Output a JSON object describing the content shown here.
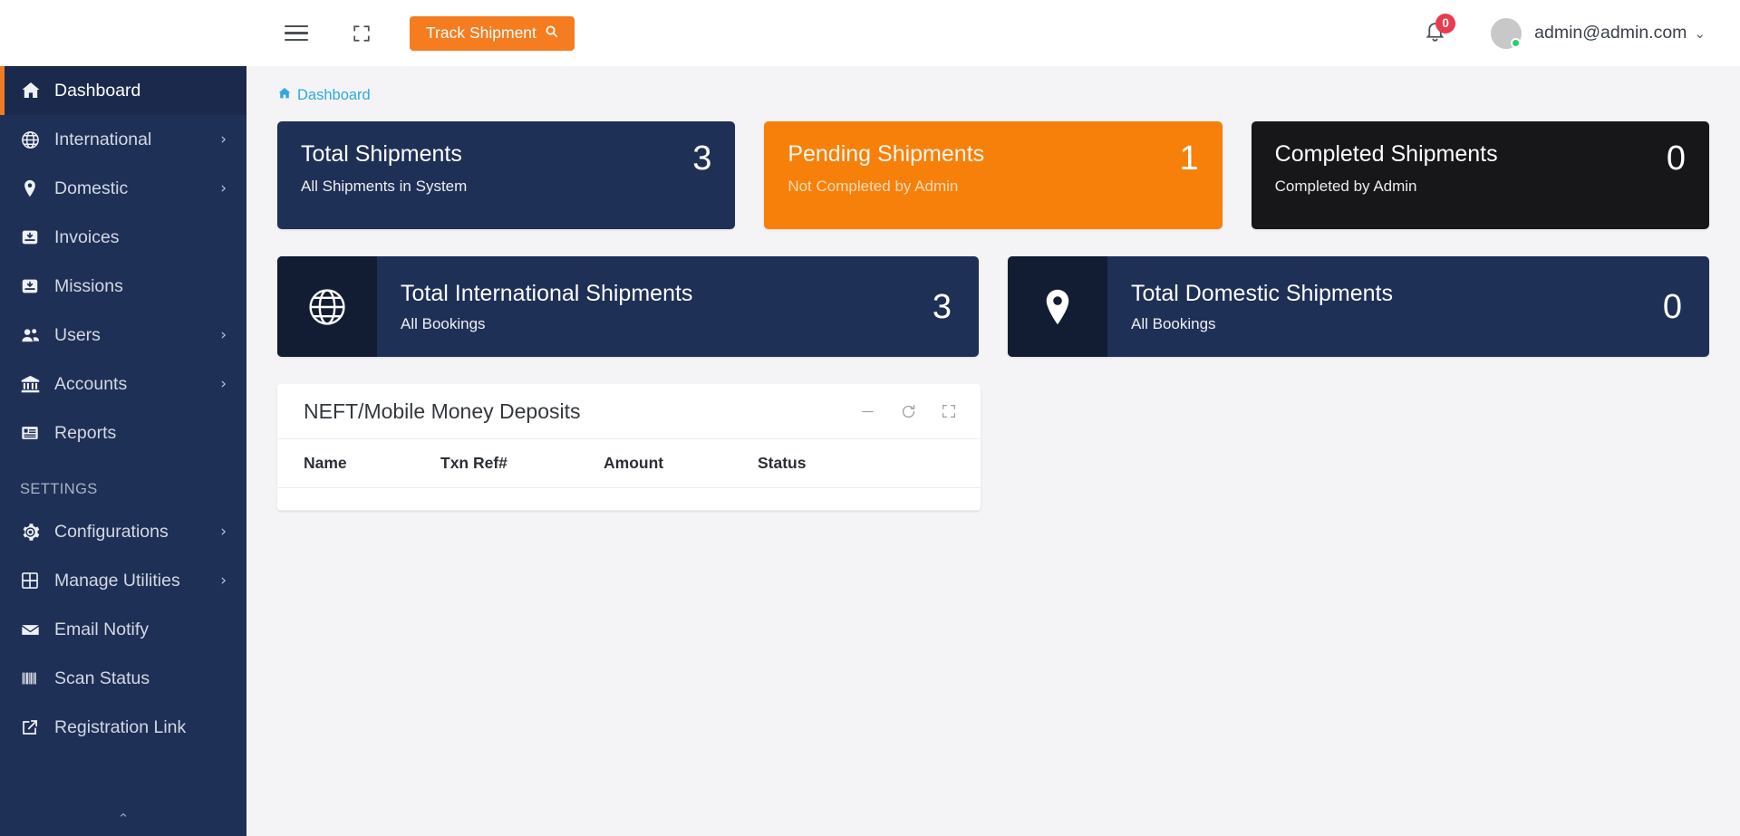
{
  "topbar": {
    "menu_icon": "hamburger-menu-icon",
    "fullscreen_icon": "fullscreen-icon",
    "track_button_label": "Track Shipment",
    "track_button_icon": "search-icon",
    "notification_icon": "bell-icon",
    "notification_count": "0",
    "user_email": "admin@admin.com",
    "user_chevron": "⌄"
  },
  "sidebar": {
    "items": [
      {
        "label": "Dashboard",
        "icon": "home-icon",
        "active": true,
        "caret": ""
      },
      {
        "label": "International",
        "icon": "globe-icon",
        "active": false,
        "caret": "›"
      },
      {
        "label": "Domestic",
        "icon": "map-pin-icon",
        "active": false,
        "caret": "›"
      },
      {
        "label": "Invoices",
        "icon": "inbox-download-icon",
        "active": false,
        "caret": ""
      },
      {
        "label": "Missions",
        "icon": "inbox-download-icon",
        "active": false,
        "caret": ""
      },
      {
        "label": "Users",
        "icon": "users-icon",
        "active": false,
        "caret": "›"
      },
      {
        "label": "Accounts",
        "icon": "bank-icon",
        "active": false,
        "caret": "›"
      },
      {
        "label": "Reports",
        "icon": "report-list-icon",
        "active": false,
        "caret": ""
      }
    ],
    "section_label": "SETTINGS",
    "settings_items": [
      {
        "label": "Configurations",
        "icon": "gear-icon",
        "caret": "›"
      },
      {
        "label": "Manage Utilities",
        "icon": "grid-icon",
        "caret": "›"
      },
      {
        "label": "Email Notify",
        "icon": "envelope-icon",
        "caret": ""
      },
      {
        "label": "Scan Status",
        "icon": "barcode-icon",
        "caret": ""
      },
      {
        "label": "Registration Link",
        "icon": "external-link-icon",
        "caret": ""
      }
    ],
    "collapse_chevron": "⌃"
  },
  "breadcrumb": {
    "icon": "home-icon",
    "label": "Dashboard"
  },
  "stats": [
    {
      "title": "Total Shipments",
      "subtitle": "All Shipments in System",
      "value": "3",
      "color": "#1f3056"
    },
    {
      "title": "Pending Shipments",
      "subtitle": "Not Completed by Admin",
      "value": "1",
      "color": "#f7800b"
    },
    {
      "title": "Completed Shipments",
      "subtitle": "Completed by Admin",
      "value": "0",
      "color": "#17171a"
    }
  ],
  "wide_stats": [
    {
      "title": "Total International Shipments",
      "subtitle": "All Bookings",
      "value": "3",
      "icon": "globe-icon"
    },
    {
      "title": "Total Domestic Shipments",
      "subtitle": "All Bookings",
      "value": "0",
      "icon": "map-pin-icon"
    }
  ],
  "panel": {
    "title": "NEFT/Mobile Money Deposits",
    "tools": [
      {
        "name": "minimize-icon"
      },
      {
        "name": "refresh-icon"
      },
      {
        "name": "expand-icon"
      }
    ],
    "columns": [
      "Name",
      "Txn Ref#",
      "Amount",
      "Status"
    ],
    "rows": []
  }
}
